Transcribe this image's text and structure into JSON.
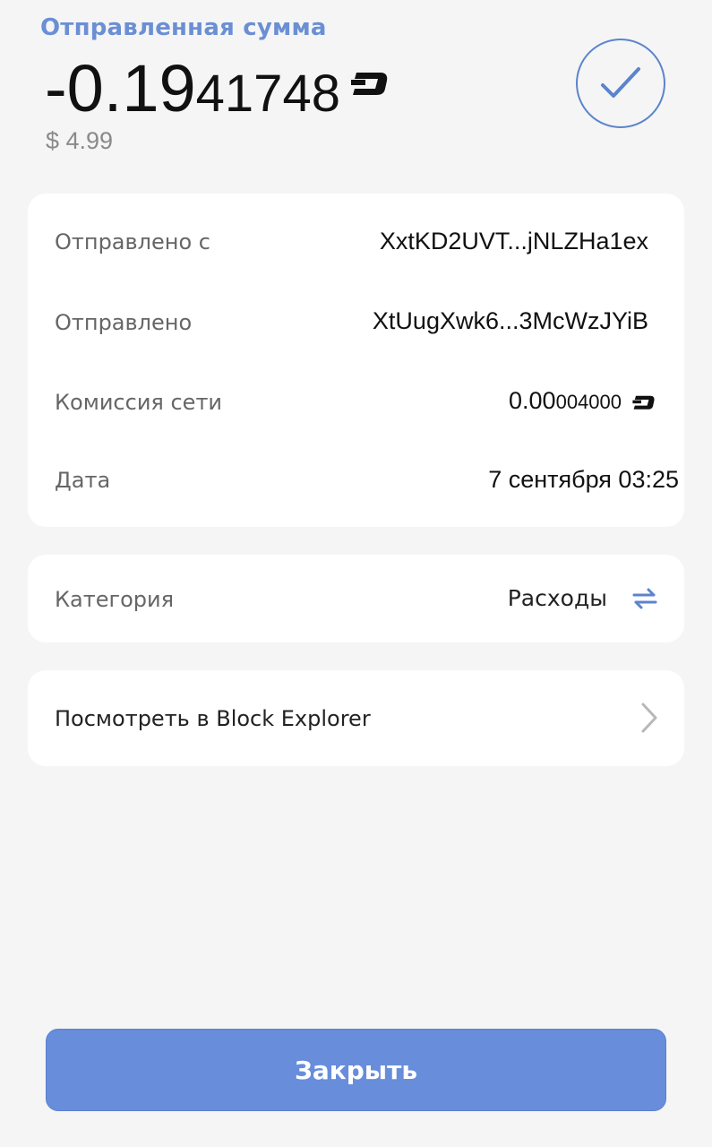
{
  "header": {
    "title": "Отправленная сумма"
  },
  "amount": {
    "main": "-0.19",
    "tail": "41748",
    "currency_icon": "dash-icon",
    "fiat": "$ 4.99"
  },
  "status_icon": "checkmark-circle-icon",
  "details": {
    "sent_from_label": "Отправлено с",
    "sent_from_value": "XxtKD2UVT...jNLZHa1ex",
    "sent_to_label": "Отправлено",
    "sent_to_value": "XtUugXwk6...3McWzJYiB",
    "fee_label": "Комиссия сети",
    "fee_main": "0.00",
    "fee_tail": "004000",
    "date_label": "Дата",
    "date_value": "7 сентября 03:25"
  },
  "category": {
    "label": "Категория",
    "value": "Расходы",
    "icon": "repeat-icon"
  },
  "explorer": {
    "label": "Посмотреть в Block Explorer",
    "icon": "chevron-right-icon"
  },
  "close_button": {
    "label": "Закрыть"
  },
  "colors": {
    "accent": "#678ddb",
    "title": "#6b8fd4",
    "background": "#f5f5f5"
  }
}
